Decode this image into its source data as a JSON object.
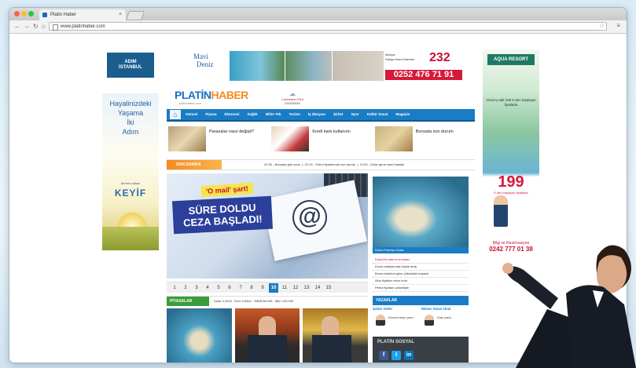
{
  "browser": {
    "tab_title": "Platin Haber",
    "url": "www.platinhaber.com"
  },
  "colors": {
    "brand_blue": "#1a7cc5",
    "brand_orange": "#f58a1f",
    "alert_red": "#d6193b",
    "market_green": "#3a9d3a"
  },
  "ads": {
    "left_small": {
      "line1": "ADIM",
      "line2": "İSTANBUL"
    },
    "left_tall": {
      "lines": [
        "Hayalinizdeki",
        "Yaşama",
        "İki",
        "Adım"
      ],
      "small": "Afortea adlası",
      "brand": "KEYİF"
    },
    "right": {
      "logo": "AQUA RESORT",
      "promo": "Yılsonu tatil 199 € den başlayan fiyatlarla",
      "price": "199",
      "price_caption": "€ den başlayan fiyatlarla",
      "caption": "Bilgi ve Rezervasyon",
      "phone": "0242 777 01 38"
    },
    "top_banner": {
      "brand_line1": "Mavi",
      "brand_line2": "Deniz",
      "info_lines": [
        "Alanya",
        "Satışa Hazır Daireler",
        "232"
      ],
      "number": "232",
      "phone": "0252 476 71 91"
    }
  },
  "site": {
    "logo_main": "PLATİN",
    "logo_accent": "HABER",
    "logo_sub": "platinhaber.com",
    "weather": {
      "date": "Cumartesi 2015",
      "label": "KARAMAN"
    },
    "nav": [
      "Güncel",
      "Piyasa",
      "Ekonomi",
      "Sağlık",
      "Bilim Tek",
      "Turizm",
      "İş dünyası",
      "Şirket",
      "Spor",
      "Kültür Sanat",
      "Magazin"
    ],
    "strip": [
      {
        "text": "Parasalar nasıl değişti?",
        "icon": "money-image"
      },
      {
        "text": "Kredi kartı kullanımı",
        "icon": "credit-card-image"
      },
      {
        "text": "Borsada son durum",
        "icon": "coins-image"
      }
    ],
    "sondakika": {
      "label": "SON DAKİKA",
      "items": [
        "22:30 - Borsada gün sonu",
        "22:15 - Petrol fiyatlarında son durum",
        "21:50 - Dolar güne nasıl başladı"
      ]
    },
    "headline": {
      "tag": "'O mail' şart!",
      "title": "SÜRE DOLDU CEZA BAŞLADI!",
      "icon": "at-sign-icon"
    },
    "pager": [
      "1",
      "2",
      "3",
      "4",
      "5",
      "6",
      "7",
      "8",
      "9",
      "10",
      "11",
      "12",
      "13",
      "14",
      "15"
    ],
    "pager_active": "10",
    "side": {
      "caption": "Dubai Palmiye Adası",
      "list": [
        "Dubai'de yatırım fırsatları",
        "Konut satışlarında büyük artış",
        "Borsa İstanbul güne yükselişle başladı",
        "Altın fiyatları rekor kırdı",
        "Petrol fiyatları yükselişte"
      ]
    },
    "piyasa": {
      "label": "PİYASALAR",
      "values": [
        "Dolar 2,3019",
        "Euro 2,8841",
        "İMKB 88.945",
        "Altın 120,430"
      ]
    },
    "yazarlar": {
      "label": "YAZARLAR",
      "authors": [
        {
          "name": "Şahin Güler",
          "title": "Ekonomi köşe yazısı"
        },
        {
          "name": "Mimar Sezar Ünal",
          "title": "Köşe yazısı"
        }
      ]
    },
    "sosyal": {
      "title": "PLATİN SOSYAL",
      "icons": [
        "f",
        "t",
        "in"
      ]
    }
  }
}
